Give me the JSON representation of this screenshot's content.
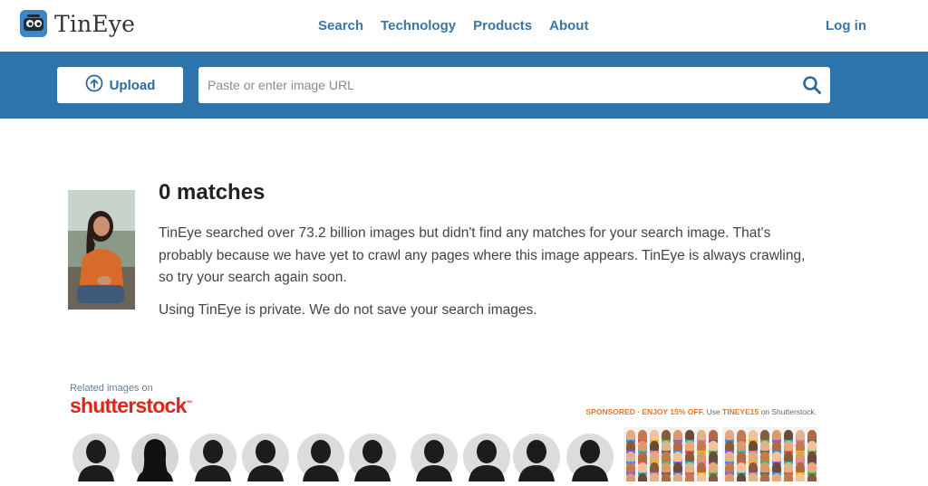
{
  "header": {
    "brand": "TinEye",
    "nav": [
      "Search",
      "Technology",
      "Products",
      "About"
    ],
    "login_label": "Log in"
  },
  "search": {
    "upload_label": "Upload",
    "url_placeholder": "Paste or enter image URL"
  },
  "result": {
    "title": "0 matches",
    "description": "TinEye searched over 73.2 billion images but didn't find any matches for your search image. That's probably because we have yet to crawl any pages where this image appears. TinEye is always crawling, so try your search again soon.",
    "privacy": "Using TinEye is private. We do not save your search images."
  },
  "related": {
    "label": "Related images on",
    "brand": "shutterstock",
    "sponsored_prefix": "SPONSORED · ENJOY 15% OFF.",
    "sponsored_use": " Use ",
    "promo_code": "TINEYE15",
    "sponsored_suffix": " on Shutterstock."
  },
  "colors": {
    "brand_blue": "#2e74ac",
    "link_blue": "#3875a8",
    "shutterstock_red": "#e2231a",
    "promo_orange": "#e8752a"
  }
}
